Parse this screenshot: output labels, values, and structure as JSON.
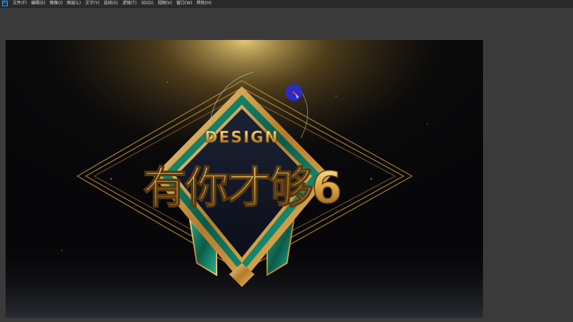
{
  "app": {
    "icon_label": "Ps",
    "menu": [
      "文件(F)",
      "编辑(E)",
      "图像(I)",
      "图层(L)",
      "文字(Y)",
      "选择(S)",
      "滤镜(T)",
      "3D(D)",
      "视图(V)",
      "窗口(W)",
      "帮助(H)"
    ]
  },
  "artwork": {
    "subtitle": "DESIGN",
    "title": "有你才够6"
  },
  "colors": {
    "menubar": "#2b2b2b",
    "workspace": "#3a3a3a",
    "canvas": "#070709",
    "gold": "#d9a441",
    "emerald": "#0f6b55",
    "cursor": "#2a2ad8"
  }
}
